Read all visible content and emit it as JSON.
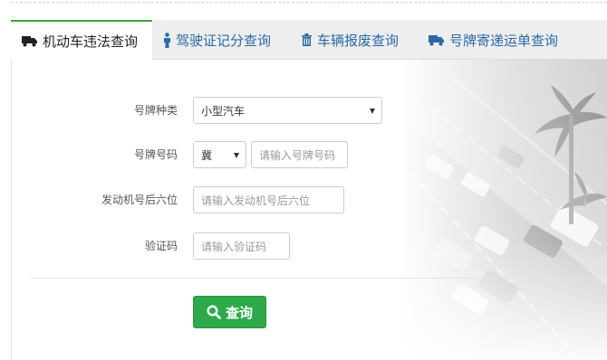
{
  "tabs": [
    {
      "label": "机动车违法查询",
      "icon": "truck-icon",
      "active": true
    },
    {
      "label": "驾驶证记分查询",
      "icon": "person-icon",
      "active": false
    },
    {
      "label": "车辆报废查询",
      "icon": "trash-icon",
      "active": false
    },
    {
      "label": "号牌寄递运单查询",
      "icon": "truck-icon",
      "active": false
    }
  ],
  "form": {
    "plate_type": {
      "label": "号牌种类",
      "value": "小型汽车"
    },
    "plate_number": {
      "label": "号牌号码",
      "province": "冀",
      "placeholder": "请输入号牌号码"
    },
    "engine": {
      "label": "发动机号后六位",
      "placeholder": "请输入发动机号后六位"
    },
    "captcha": {
      "label": "验证码",
      "placeholder": "请输入验证码"
    }
  },
  "query_button": {
    "label": "查询",
    "icon": "search-icon"
  },
  "colors": {
    "accent_green": "#2eaa4a",
    "tab_link": "#2a6aa6",
    "active_border": "#3ba33b"
  }
}
